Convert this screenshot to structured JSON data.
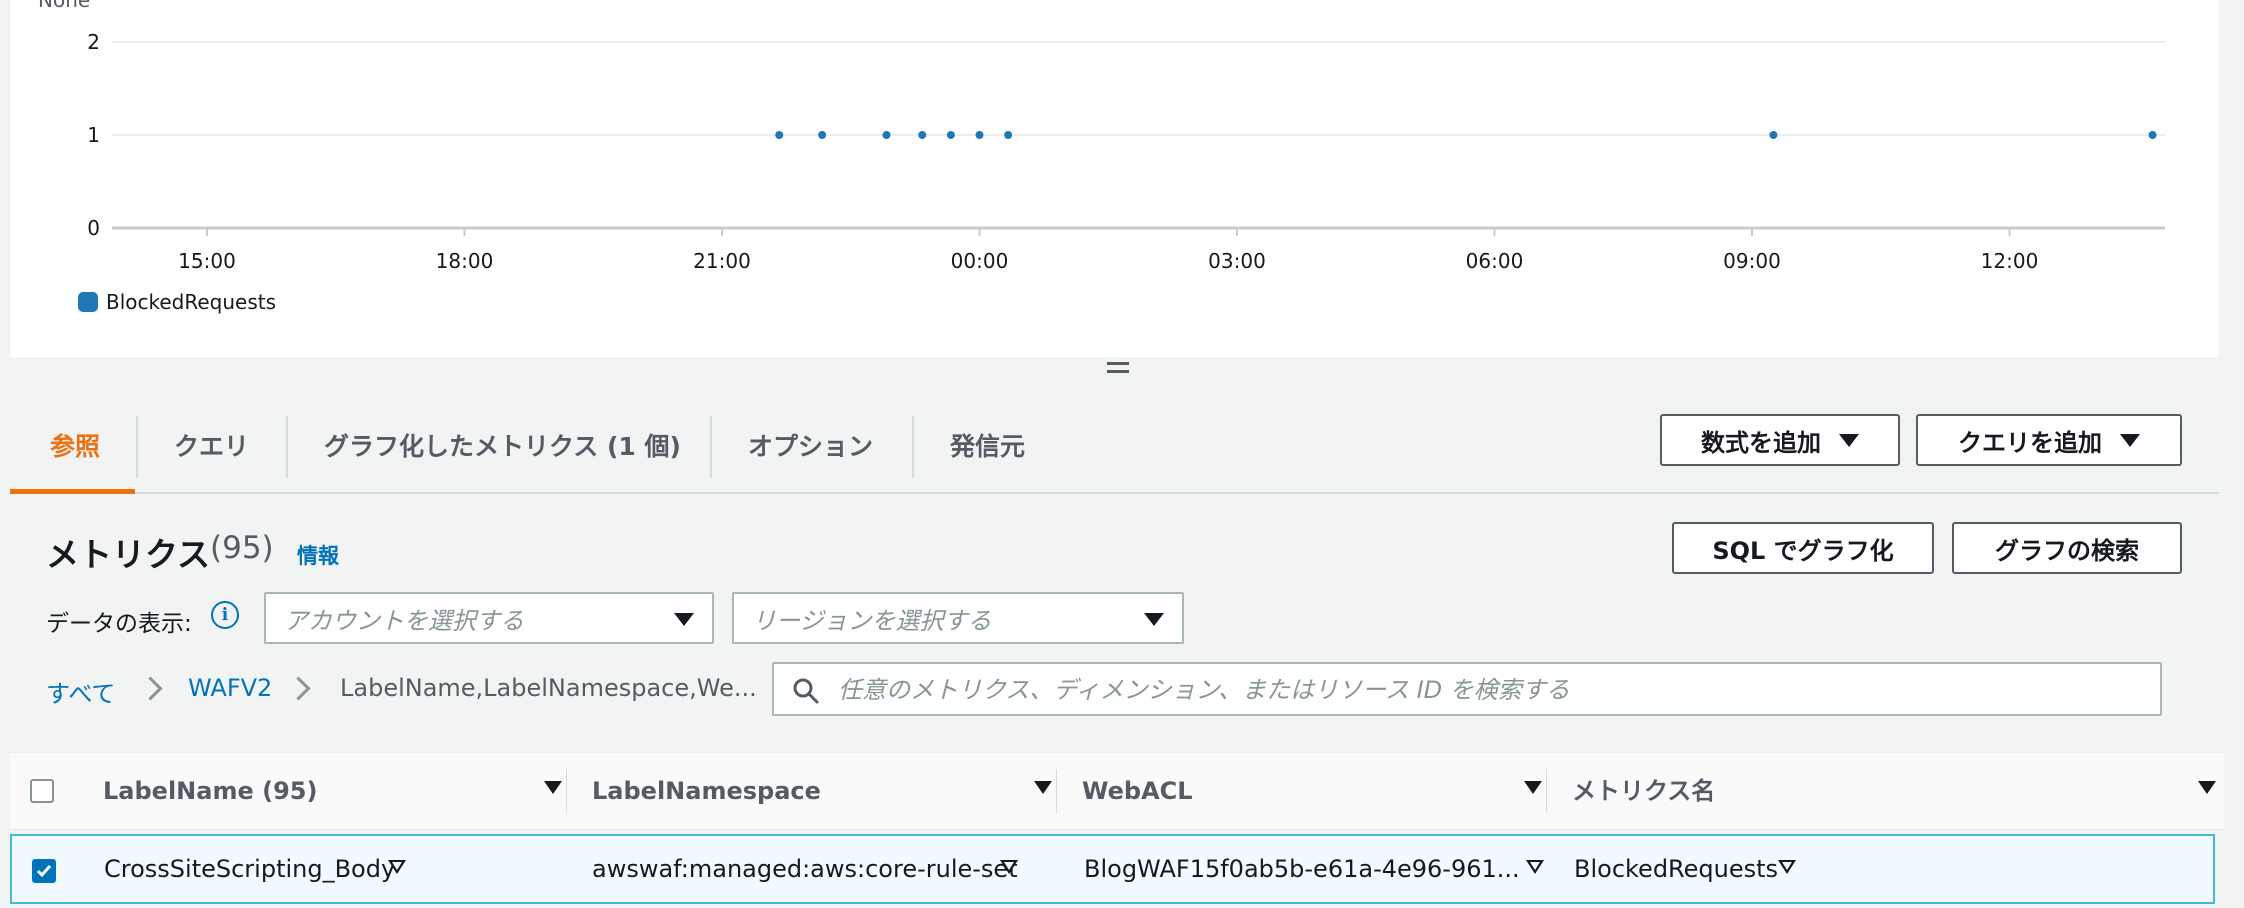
{
  "chart_data": {
    "type": "scatter",
    "unit_label": "None",
    "y_ticks": [
      "0",
      "1",
      "2"
    ],
    "ylim": [
      0,
      2
    ],
    "x_ticks": [
      "15:00",
      "18:00",
      "21:00",
      "00:00",
      "03:00",
      "06:00",
      "09:00",
      "12:00"
    ],
    "series": [
      {
        "name": "BlockedRequests",
        "color": "#1f77b4",
        "points": [
          {
            "x": "21:40",
            "y": 1
          },
          {
            "x": "22:10",
            "y": 1
          },
          {
            "x": "22:55",
            "y": 1
          },
          {
            "x": "23:20",
            "y": 1
          },
          {
            "x": "23:40",
            "y": 1
          },
          {
            "x": "00:00",
            "y": 1
          },
          {
            "x": "00:20",
            "y": 1
          },
          {
            "x": "09:15",
            "y": 1
          },
          {
            "x": "13:40",
            "y": 1
          }
        ]
      }
    ],
    "legend": {
      "label": "BlockedRequests",
      "placement": "bottom-left"
    },
    "grid": true
  },
  "tabs": {
    "items": [
      {
        "label": "参照",
        "active": true
      },
      {
        "label": "クエリ"
      },
      {
        "label": "グラフ化したメトリクス (1 個)"
      },
      {
        "label": "オプション"
      },
      {
        "label": "発信元"
      }
    ],
    "add_math_button": "数式を追加",
    "add_query_button": "クエリを追加"
  },
  "metrics": {
    "title": "メトリクス",
    "count": "(95)",
    "info": "情報",
    "sql_button": "SQL でグラフ化",
    "search_graphs_button": "グラフの検索",
    "display_label": "データの表示:",
    "account_placeholder": "アカウントを選択する",
    "region_placeholder": "リージョンを選択する",
    "breadcrumb": [
      "すべて",
      "WAFV2",
      "LabelName,LabelNamespace,We..."
    ],
    "search_placeholder": "任意のメトリクス、ディメンション、またはリソース ID を検索する"
  },
  "table": {
    "columns": [
      "LabelName (95)",
      "LabelNamespace",
      "WebACL",
      "メトリクス名"
    ],
    "rows": [
      {
        "checked": true,
        "cells": [
          "CrossSiteScripting_Body",
          "awswaf:managed:aws:core-rule-set",
          "BlogWAF15f0ab5b-e61a-4e96-961...",
          "BlockedRequests"
        ]
      }
    ]
  },
  "icons": {
    "info": "info-icon",
    "search": "search-icon",
    "dropdown": "caret-down-icon",
    "breadcrumb_separator": "chevron-right-icon",
    "filter": "filter-icon"
  }
}
